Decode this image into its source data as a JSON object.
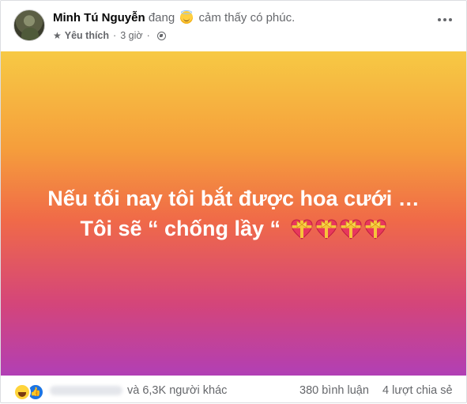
{
  "post": {
    "author": "Minh Tú Nguyễn",
    "feeling_prefix": "đang",
    "feeling_emoji": "smiling-face-with-halo",
    "feeling_text": "cảm thấy có phúc.",
    "audience_label": "Yêu thích",
    "separator": "·",
    "time": "3 giờ",
    "privacy_icon": "globe-icon",
    "more_icon": "ellipsis-icon"
  },
  "content": {
    "line1": "Nếu tối nay tôi bắt được hoa cưới …",
    "line2": "Tôi sẽ “ chống lầy “",
    "emoji_name": "heart-with-ribbon",
    "emoji_count": 4,
    "background": {
      "top": "#f7c944",
      "middle": "#f06a48",
      "bottom": "#b13fb5"
    }
  },
  "footer": {
    "reactions": [
      "haha-icon",
      "like-icon"
    ],
    "others_text": "và 6,3K người khác",
    "comments_text": "380 bình luận",
    "shares_text": "4 lượt chia sẻ"
  },
  "colors": {
    "muted": "#65676b",
    "like_blue": "#1b74e4",
    "text": "#050505"
  }
}
